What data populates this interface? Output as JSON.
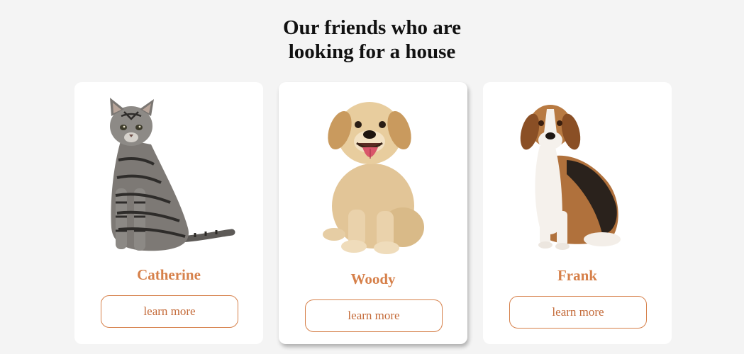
{
  "section": {
    "title_line1": "Our friends who are",
    "title_line2": "looking for a house"
  },
  "pets": [
    {
      "name": "Catherine",
      "button_label": "learn more",
      "image_icon": "tabby-cat-icon"
    },
    {
      "name": "Woody",
      "button_label": "learn more",
      "image_icon": "golden-puppy-icon"
    },
    {
      "name": "Frank",
      "button_label": "learn more",
      "image_icon": "beagle-dog-icon"
    }
  ],
  "colors": {
    "accent": "#d6804a",
    "background": "#f4f4f4",
    "card": "#ffffff",
    "title": "#111111"
  }
}
